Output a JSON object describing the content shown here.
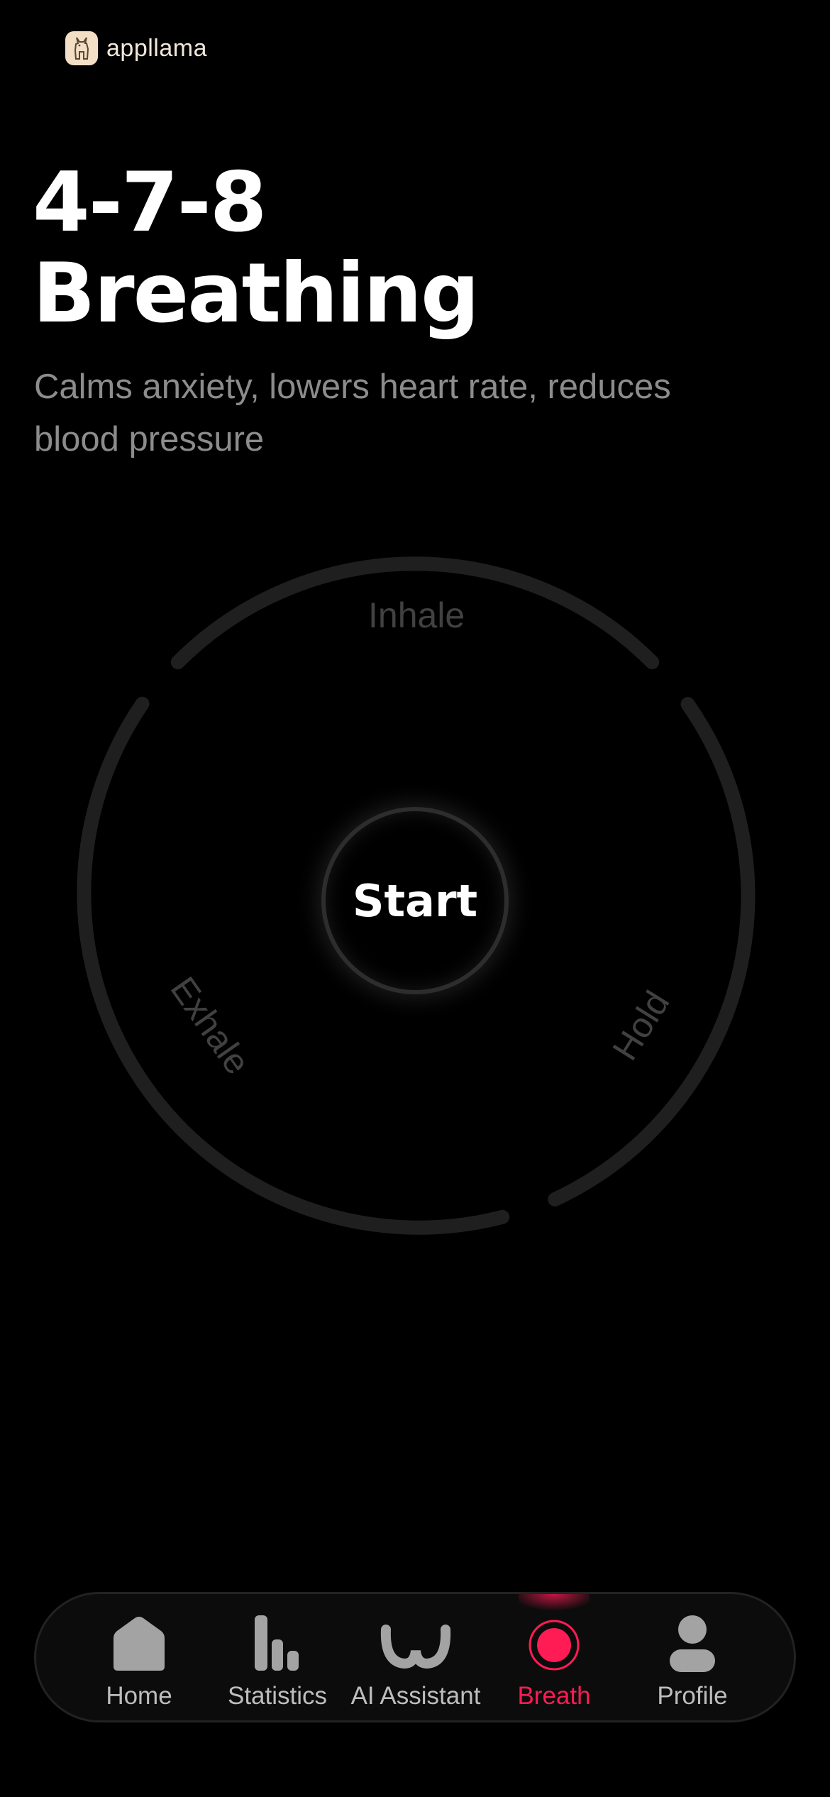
{
  "brand": {
    "name": "appllama",
    "icon": "llama-icon"
  },
  "page": {
    "title_line1": "4-7-8",
    "title_line2": "Breathing",
    "subtitle": "Calms anxiety, lowers heart rate, reduces blood pressure"
  },
  "breath_cycle": {
    "phases": [
      "Inhale",
      "Hold",
      "Exhale"
    ],
    "start_label": "Start"
  },
  "tabbar": {
    "items": [
      {
        "label": "Home",
        "icon": "home-icon"
      },
      {
        "label": "Statistics",
        "icon": "bar-chart-icon"
      },
      {
        "label": "AI Assistant",
        "icon": "ai-assistant-icon"
      },
      {
        "label": "Breath",
        "icon": "breath-icon"
      },
      {
        "label": "Profile",
        "icon": "profile-icon"
      }
    ],
    "active_index": 3
  },
  "colors": {
    "background": "#000000",
    "accent": "#ff1b54",
    "ring": "#1f1f1f",
    "muted_text": "#8c8c8c"
  }
}
